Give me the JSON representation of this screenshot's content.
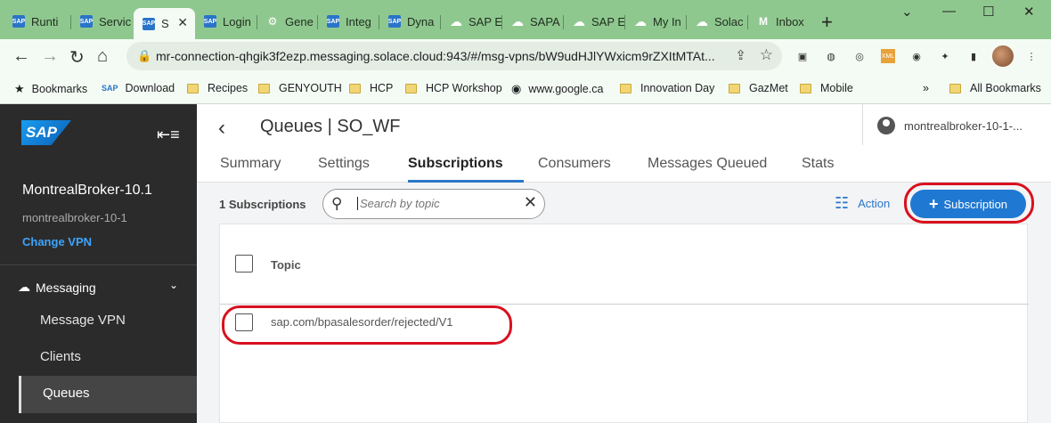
{
  "browser": {
    "tabs": [
      {
        "label": "Runti",
        "icon": "sap"
      },
      {
        "label": "Servic",
        "icon": "sap"
      },
      {
        "label": "S",
        "icon": "sap"
      },
      {
        "label": "Login",
        "icon": "sap"
      },
      {
        "label": "Gene",
        "icon": "openai"
      },
      {
        "label": "Integ",
        "icon": "sap"
      },
      {
        "label": "Dyna",
        "icon": "sap"
      },
      {
        "label": "SAP E",
        "icon": "cloud"
      },
      {
        "label": "SAPA",
        "icon": "cloud"
      },
      {
        "label": "SAP E",
        "icon": "cloud"
      },
      {
        "label": "My In",
        "icon": "cloud"
      },
      {
        "label": "Solac",
        "icon": "cloud"
      },
      {
        "label": "Inbox",
        "icon": "gmail"
      }
    ],
    "url": "mr-connection-qhgik3f2ezp.messaging.solace.cloud:943/#/msg-vpns/bW9udHJlYWxicm9rZXItMTAt...",
    "bookmarks": [
      {
        "label": "Bookmarks",
        "icon": "star"
      },
      {
        "label": "Download",
        "icon": "sap"
      },
      {
        "label": "Recipes",
        "icon": "folder"
      },
      {
        "label": "GENYOUTH",
        "icon": "folder"
      },
      {
        "label": "HCP",
        "icon": "folder"
      },
      {
        "label": "HCP Workshop",
        "icon": "folder"
      },
      {
        "label": "www.google.ca",
        "icon": "globe"
      },
      {
        "label": "Innovation Day",
        "icon": "folder"
      },
      {
        "label": "GazMet",
        "icon": "folder"
      },
      {
        "label": "Mobile",
        "icon": "folder"
      }
    ],
    "more_bookmarks": "»",
    "all_bookmarks": "All Bookmarks"
  },
  "sidebar": {
    "logo": "SAP",
    "broker_name": "MontrealBroker-10.1",
    "broker_id": "montrealbroker-10-1",
    "change_vpn": "Change VPN",
    "section": "Messaging",
    "items": [
      "Message VPN",
      "Clients",
      "Queues"
    ]
  },
  "header": {
    "title": "Queues | SO_WF",
    "user": "montrealbroker-10-1-..."
  },
  "tabs": [
    "Summary",
    "Settings",
    "Subscriptions",
    "Consumers",
    "Messages Queued",
    "Stats"
  ],
  "active_tab": "Subscriptions",
  "toolbar": {
    "count": "1 Subscriptions",
    "search_placeholder": "Search by topic",
    "action": "Action",
    "add_button": "+ Subscription",
    "add_label": "Subscription"
  },
  "table": {
    "header": "Topic",
    "rows": [
      "sap.com/bpasalesorder/rejected/V1"
    ]
  },
  "colors": {
    "primary": "#1f78d1",
    "annotation": "#d9101f",
    "sidebar": "#2b2b2b"
  }
}
